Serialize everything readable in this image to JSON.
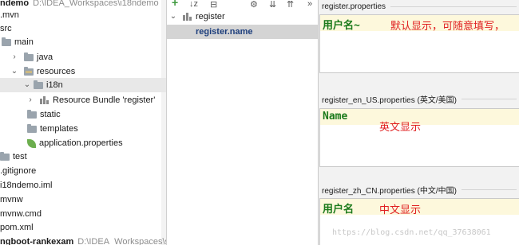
{
  "tree": {
    "items": [
      {
        "label": "ndemo",
        "extra": "D:\\IDEA_Workspaces\\i18ndemo",
        "arrow": "",
        "icon": "none",
        "bold": true
      },
      {
        "label": ".mvn",
        "arrow": "",
        "icon": "none"
      },
      {
        "label": "src",
        "arrow": "",
        "icon": "none"
      },
      {
        "label": "main",
        "arrow": "",
        "icon": "folder"
      },
      {
        "label": "java",
        "arrow": "›",
        "icon": "folder"
      },
      {
        "label": "resources",
        "arrow": "⌄",
        "icon": "folder-res"
      },
      {
        "label": "i18n",
        "arrow": "⌄",
        "icon": "folder"
      },
      {
        "label": "Resource Bundle 'register'",
        "arrow": "›",
        "icon": "bundle"
      },
      {
        "label": "static",
        "arrow": "",
        "icon": "folder"
      },
      {
        "label": "templates",
        "arrow": "",
        "icon": "folder"
      },
      {
        "label": "application.properties",
        "arrow": "",
        "icon": "leaf"
      },
      {
        "label": "test",
        "arrow": "",
        "icon": "folder"
      },
      {
        "label": ".gitignore",
        "arrow": "",
        "icon": "none"
      },
      {
        "label": "i18ndemo.iml",
        "arrow": "",
        "icon": "none"
      },
      {
        "label": "mvnw",
        "arrow": "",
        "icon": "none"
      },
      {
        "label": "mvnw.cmd",
        "arrow": "",
        "icon": "none"
      },
      {
        "label": "pom.xml",
        "arrow": "",
        "icon": "none"
      },
      {
        "label": "ngboot-rankexam",
        "extra": "D:\\IDEA_Workspaces\\s",
        "arrow": "",
        "icon": "none",
        "bold": true
      }
    ]
  },
  "bundle": {
    "toolbar": {
      "add": "+",
      "sort": "↓z",
      "more": "»"
    },
    "root_label": "register",
    "root_arrow": "⌄",
    "key_label": "register.name"
  },
  "editor": {
    "sections": [
      {
        "file": "register.properties",
        "value": "用户名~",
        "note": "默认显示，可随意填写，"
      },
      {
        "file": "register_en_US.properties (英文/美国)",
        "value": "Name",
        "note": "英文显示"
      },
      {
        "file": "register_zh_CN.properties (中文/中国)",
        "value": "用户名",
        "note": "中文显示"
      }
    ]
  },
  "watermark": "https://blog.csdn.net/qq_37638061",
  "colors": {
    "selection": "#d4d4d4",
    "key_text": "#1d3e7c",
    "value_text": "#1b7a1b",
    "note_text": "#e02020",
    "current_line": "#fdf8dc"
  }
}
